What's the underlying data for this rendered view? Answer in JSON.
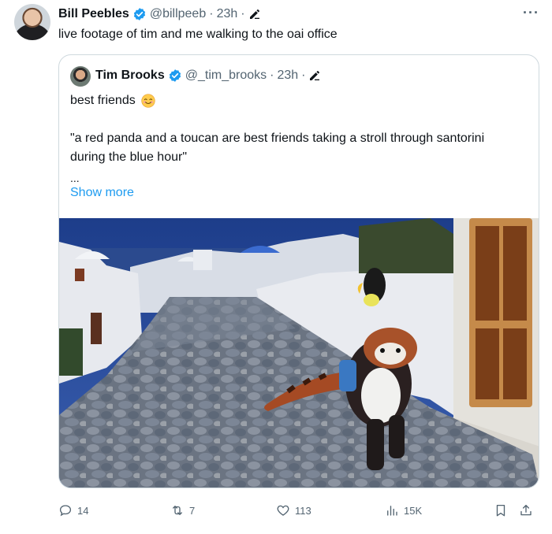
{
  "author": {
    "name": "Bill Peebles",
    "handle": "@billpeeb",
    "sep": "·",
    "time": "23h",
    "sep2": "·",
    "text": "live footage of tim and me walking to the oai office",
    "more_label": "···"
  },
  "quoted": {
    "name": "Tim Brooks",
    "handle": "@_tim_brooks",
    "sep": "·",
    "time": "23h",
    "sep2": "·",
    "line1": "best friends",
    "prompt": "\"a red panda and a toucan are best friends taking a stroll through santorini during the blue hour\"",
    "ellipsis": "...",
    "show_more": "Show more",
    "media_description_icon": "video-thumbnail"
  },
  "actions": {
    "replies": "14",
    "reposts": "7",
    "likes": "113",
    "views": "15K"
  },
  "colors": {
    "verified": "#1d9bf0",
    "link": "#1d9bf0",
    "muted": "#536471",
    "border": "#cfd9de"
  }
}
